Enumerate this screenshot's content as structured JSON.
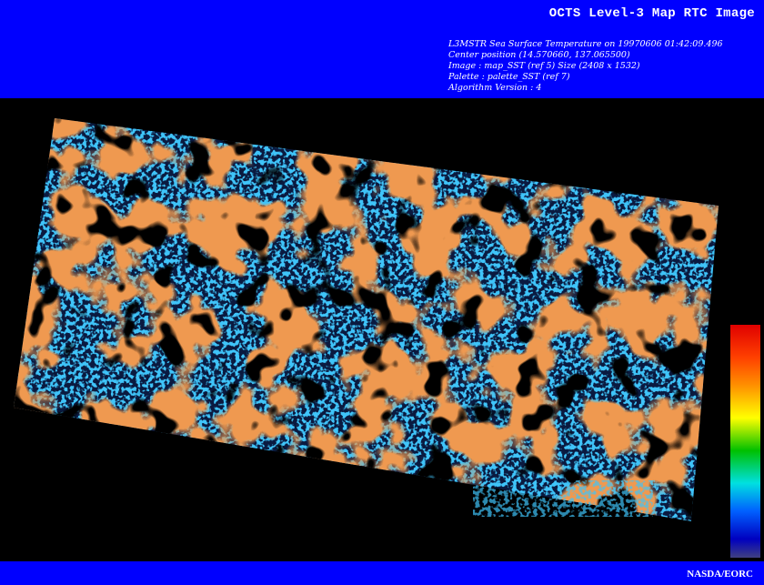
{
  "header": {
    "title": "OCTS Level-3 Map RTC Image",
    "lines": [
      "L3MSTR Sea Surface Temperature on 19970606 01:42:09.496",
      "Center position (14.570660, 137.065500)",
      "Image : map_SST (ref 5) Size (2408 x 1532)",
      "Palette : palette_SST (ref 7)",
      "Algorithm Version : 4"
    ]
  },
  "footer": {
    "credit": "NASDA/EORC"
  },
  "colors": {
    "banner": "#0000ff",
    "background": "#000000",
    "palette": [
      "#e00000",
      "#ff4000",
      "#ff9000",
      "#ffff00",
      "#00c000",
      "#00e0e0",
      "#0060ff",
      "#0000c0",
      "#404080"
    ]
  }
}
